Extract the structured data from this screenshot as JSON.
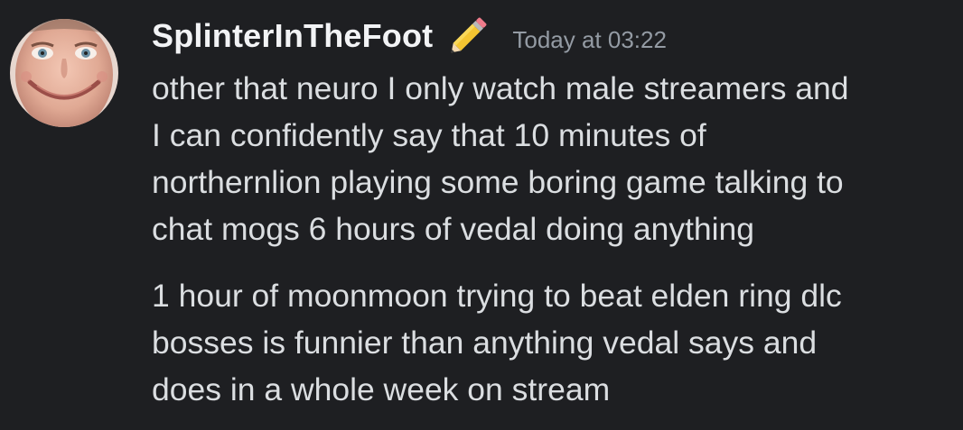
{
  "message": {
    "author": "SplinterInTheFoot",
    "timestamp": "Today at 03:22",
    "badge_icon": "pencil-emoji",
    "paragraphs": [
      {
        "lines": [
          "other that neuro I only watch male streamers and",
          "I can confidently say that 10 minutes of",
          "northernlion playing some boring game talking to",
          "chat mogs 6 hours of vedal doing anything"
        ]
      },
      {
        "lines": [
          "1 hour of moonmoon trying to beat elden ring dlc",
          "bosses is funnier than anything vedal says and",
          "does in a whole week on stream"
        ]
      }
    ]
  },
  "colors": {
    "background": "#1e1f22",
    "username": "#f2f3f5",
    "timestamp": "#949ba4",
    "message_text": "#dbdee1"
  }
}
